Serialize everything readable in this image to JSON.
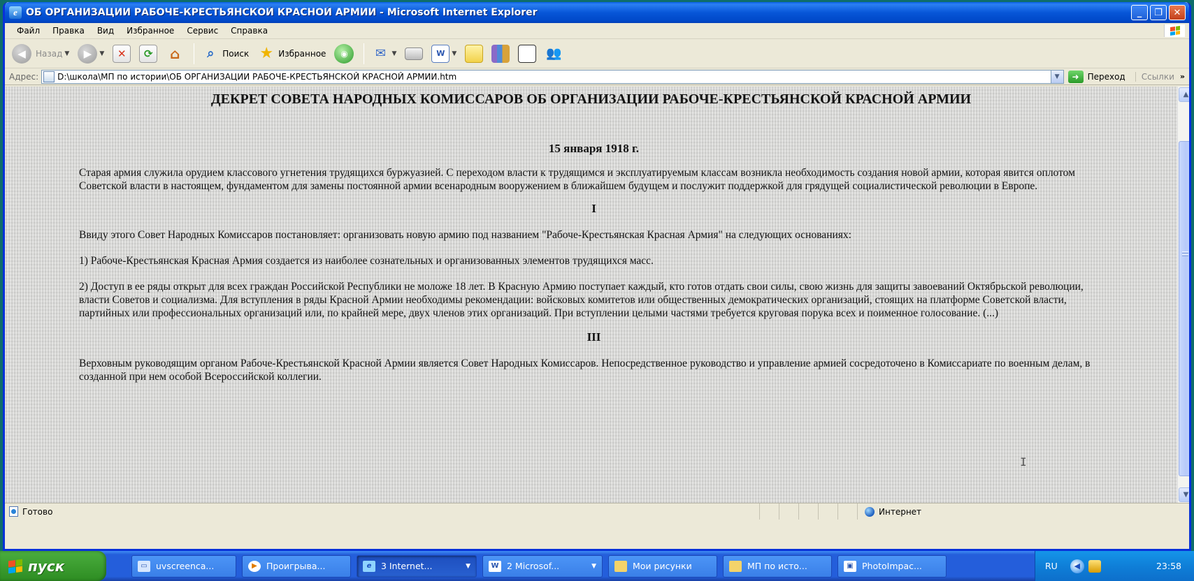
{
  "window": {
    "title": "ОБ ОРГАНИЗАЦИИ РАБОЧЕ-КРЕСТЬЯНСКОЙ КРАСНОЙ АРМИИ - Microsoft Internet Explorer"
  },
  "menu": [
    "Файл",
    "Правка",
    "Вид",
    "Избранное",
    "Сервис",
    "Справка"
  ],
  "toolbar": {
    "back": "Назад",
    "search": "Поиск",
    "favorites": "Избранное"
  },
  "address": {
    "label": "Адрес:",
    "url": "D:\\школа\\МП по истории\\ОБ ОРГАНИЗАЦИИ РАБОЧЕ-КРЕСТЬЯНСКОЙ КРАСНОЙ АРМИИ.htm",
    "go": "Переход",
    "links": "Ссылки"
  },
  "document": {
    "heading": "ДЕКРЕТ СОВЕТА НАРОДНЫХ КОМИССАРОВ ОБ ОРГАНИЗАЦИИ РАБОЧЕ-КРЕСТЬЯНСКОЙ КРАСНОЙ АРМИИ",
    "date": "15 января 1918 г.",
    "intro": "Старая армия служила орудием классового угнетения трудящихся буржуазией. С переходом власти к трудящимся и эксплуатируемым классам возникла необходимость создания новой армии, которая явится оплотом Советской власти в настоящем, фундаментом для замены постоянной армии всенародным вооружением в ближайшем будущем и послужит поддержкой для грядущей социалистической революции в Европе.",
    "section_1": "I",
    "p1": "Ввиду этого Совет Народных Комиссаров постановляет: организовать новую армию под названием \"Рабоче-Крестьянская Красная Армия\" на следующих основаниях:",
    "p2": "1) Рабоче-Крестьянская Красная Армия создается из наиболее сознательных и организованных элементов трудящихся масс.",
    "p3": "2) Доступ в ее ряды открыт для всех граждан Российской Республики не моложе 18 лет. В Красную Армию поступает каждый, кто готов отдать свои силы, свою жизнь для защиты завоеваний Октябрьской революции, власти Советов и социализма. Для вступления в ряды Красной Армии необходимы рекомендации: войсковых комитетов или общественных демократических организаций, стоящих на платформе Советской власти, партийных или профессиональных организаций или, по крайней мере, двух членов этих организаций. При вступлении целыми частями требуется круговая порука всех и поименное голосование. (...)",
    "section_3": "III",
    "p4": "Верховным руководящим органом Рабоче-Крестьянской Красной Армии является Совет Народных Комиссаров. Непосредственное руководство и управление армией сосредоточено в Комиссариате по военным делам, в созданной при нем особой Всероссийской коллегии."
  },
  "status": {
    "left": "Готово",
    "zone": "Интернет"
  },
  "taskbar": {
    "start": "пуск",
    "tasks": [
      "uvscreenca...",
      "Проигрыва...",
      "3 Internet...",
      "2 Microsof...",
      "Мои рисунки",
      "МП по исто...",
      "PhotoImpac..."
    ],
    "lang": "RU",
    "clock": "23:58"
  }
}
